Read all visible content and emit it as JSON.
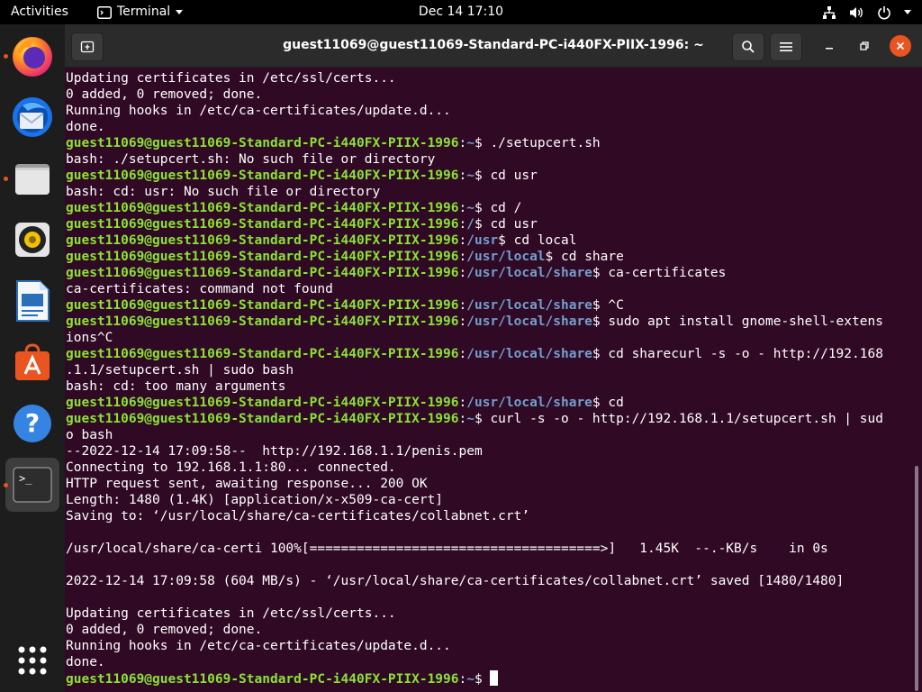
{
  "topbar": {
    "activities": "Activities",
    "app_menu": "Terminal",
    "clock": "Dec 14  17:10"
  },
  "dock": {
    "apps": [
      {
        "name": "firefox",
        "running": true
      },
      {
        "name": "thunderbird",
        "running": false
      },
      {
        "name": "files",
        "running": true
      },
      {
        "name": "rhythmbox",
        "running": false
      },
      {
        "name": "libreoffice-writer",
        "running": false
      },
      {
        "name": "ubuntu-software",
        "running": false
      },
      {
        "name": "help",
        "running": false
      },
      {
        "name": "terminal",
        "running": true
      }
    ]
  },
  "window": {
    "title": "guest11069@guest11069-Standard-PC-i440FX-PIIX-1996: ~"
  },
  "terminal": {
    "host": "guest11069@guest11069-Standard-PC-i440FX-PIIX-1996",
    "lines": [
      {
        "text": "Updating certificates in /etc/ssl/certs..."
      },
      {
        "text": "0 added, 0 removed; done."
      },
      {
        "text": "Running hooks in /etc/ca-certificates/update.d..."
      },
      {
        "text": "done."
      },
      {
        "path": "~",
        "cmd": "./setupcert.sh"
      },
      {
        "text": "bash: ./setupcert.sh: No such file or directory"
      },
      {
        "path": "~",
        "cmd": "cd usr"
      },
      {
        "text": "bash: cd: usr: No such file or directory"
      },
      {
        "path": "~",
        "cmd": "cd /"
      },
      {
        "path": "/",
        "cmd": "cd usr"
      },
      {
        "path": "/usr",
        "cmd": "cd local"
      },
      {
        "path": "/usr/local",
        "cmd": "cd share"
      },
      {
        "path": "/usr/local/share",
        "cmd": "ca-certificates"
      },
      {
        "text": "ca-certificates: command not found"
      },
      {
        "path": "/usr/local/share",
        "cmd": "^C"
      },
      {
        "path": "/usr/local/share",
        "cmd": "sudo apt install gnome-shell-extens"
      },
      {
        "text": "ions^C"
      },
      {
        "path": "/usr/local/share",
        "cmd": "cd sharecurl -s -o - http://192.168"
      },
      {
        "text": ".1.1/setupcert.sh | sudo bash"
      },
      {
        "text": "bash: cd: too many arguments"
      },
      {
        "path": "/usr/local/share",
        "cmd": "cd"
      },
      {
        "path": "~",
        "cmd": "curl -s -o - http://192.168.1.1/setupcert.sh | sud"
      },
      {
        "text": "o bash"
      },
      {
        "text": "--2022-12-14 17:09:58--  http://192.168.1.1/penis.pem"
      },
      {
        "text": "Connecting to 192.168.1.1:80... connected."
      },
      {
        "text": "HTTP request sent, awaiting response... 200 OK"
      },
      {
        "text": "Length: 1480 (1.4K) [application/x-x509-ca-cert]"
      },
      {
        "text": "Saving to: ‘/usr/local/share/ca-certificates/collabnet.crt’"
      },
      {
        "text": ""
      },
      {
        "text": "/usr/local/share/ca-certi 100%[=====================================>]   1.45K  --.-KB/s    in 0s"
      },
      {
        "text": ""
      },
      {
        "text": "2022-12-14 17:09:58 (604 MB/s) - ‘/usr/local/share/ca-certificates/collabnet.crt’ saved [1480/1480]"
      },
      {
        "text": ""
      },
      {
        "text": "Updating certificates in /etc/ssl/certs..."
      },
      {
        "text": "0 added, 0 removed; done."
      },
      {
        "text": "Running hooks in /etc/ca-certificates/update.d..."
      },
      {
        "text": "done."
      },
      {
        "path": "~",
        "cmd": "",
        "cursor": true
      }
    ]
  },
  "colors": {
    "terminal_bg": "#300a24",
    "prompt_host": "#8ae234",
    "prompt_path": "#729fcf",
    "accent": "#e95420"
  }
}
